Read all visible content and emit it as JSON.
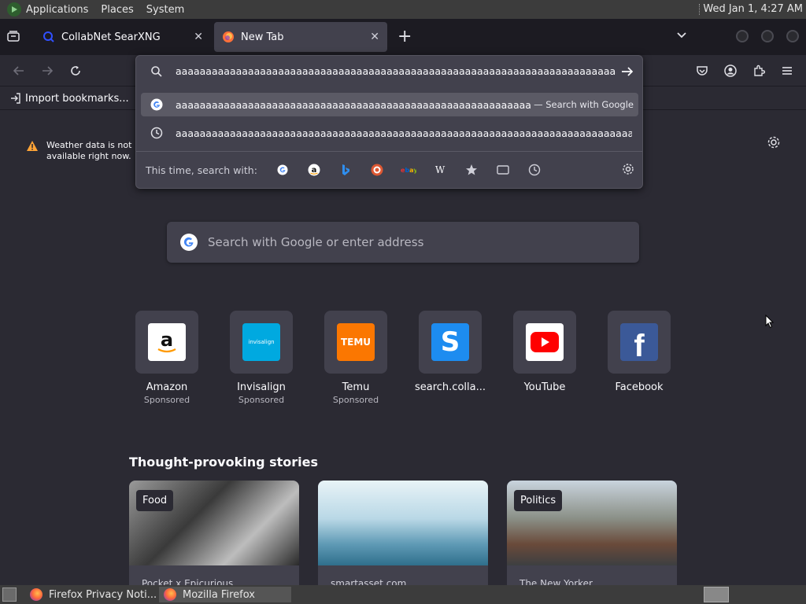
{
  "system_panel": {
    "menus": [
      "Applications",
      "Places",
      "System"
    ],
    "clock": "Wed Jan  1,  4:27 AM"
  },
  "tabs": [
    {
      "label": "CollabNet SearXNG",
      "active": false
    },
    {
      "label": "New Tab",
      "active": true
    }
  ],
  "bookmarks": {
    "import_label": "Import bookmarks..."
  },
  "urlbar": {
    "typed_text": "aaaaaaaaaaaaaaaaaaaaaaaaaaaaaaaaaaaaaaaaaaaaaaaaaaaaaaaaaaaaaaaaaaaaaaaaaaaaaaaaaaaaaaaaaaaa",
    "suggestions": [
      {
        "text": "aaaaaaaaaaaaaaaaaaaaaaaaaaaaaaaaaaaaaaaaaaaaaaaaaaaaaaaaaaaaaaaaaaaaaaaaaaaaaaaaaaaa",
        "action": "— Search with Google",
        "icon": "google-icon"
      },
      {
        "text": "aaaaaaaaaaaaaaaaaaaaaaaaaaaaaaaaaaaaaaaaaaaaaaaaaaaaaaaaaaaaaaaaaaaaaaaaaaaaaaaaaaaaaaaaaaaaaaaaaaaaaa",
        "action": "",
        "icon": "history-icon"
      }
    ],
    "one_off_label": "This time, search with:",
    "engines": [
      "google",
      "amazon",
      "bing",
      "duckduckgo",
      "ebay",
      "wikipedia",
      "bookmarks",
      "tabs",
      "history"
    ]
  },
  "weather": {
    "message": "Weather data is not available right now."
  },
  "search": {
    "placeholder": "Search with Google or enter address"
  },
  "top_sites": [
    {
      "name": "Amazon",
      "sponsored": "Sponsored",
      "icon": "amazon-icon"
    },
    {
      "name": "Invisalign",
      "sponsored": "Sponsored",
      "icon": "invisalign-icon",
      "logo_text": "invisalign"
    },
    {
      "name": "Temu",
      "sponsored": "Sponsored",
      "icon": "temu-icon",
      "logo_text": "TEMU"
    },
    {
      "name": "search.colla...",
      "sponsored": "",
      "icon": "search-collab-icon",
      "logo_text": "S"
    },
    {
      "name": "YouTube",
      "sponsored": "",
      "icon": "youtube-icon"
    },
    {
      "name": "Facebook",
      "sponsored": "",
      "icon": "facebook-icon",
      "logo_text": "f"
    }
  ],
  "stories": {
    "title": "Thought-provoking stories",
    "items": [
      {
        "tag": "Food",
        "source": "Pocket x Epicurious"
      },
      {
        "tag": "",
        "source": "smartasset.com"
      },
      {
        "tag": "Politics",
        "source": "The New Yorker"
      }
    ]
  },
  "taskbar": {
    "items": [
      "Firefox Privacy Noti...",
      "Mozilla Firefox"
    ]
  },
  "colors": {
    "accent": "#0061e0",
    "background": "#2b2a33",
    "surface": "#42414d"
  }
}
